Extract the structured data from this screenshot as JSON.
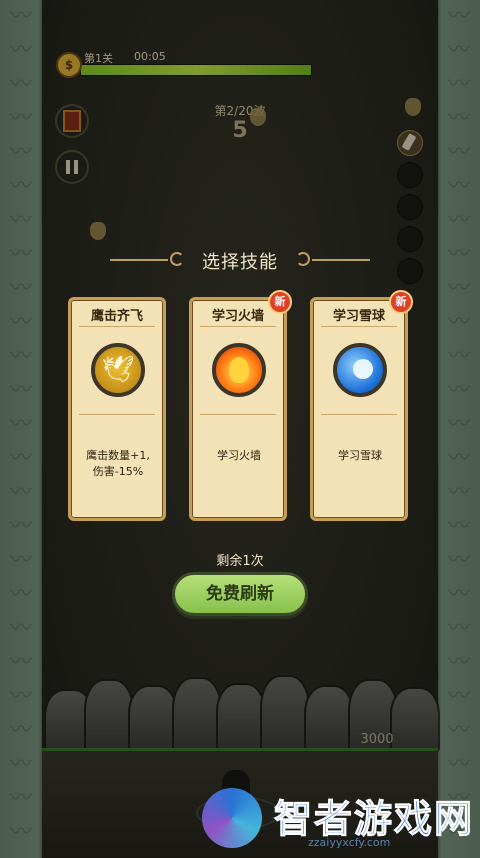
{
  "hud": {
    "level_name": "第1关",
    "timer": "00:05",
    "level_icon_glyph": "$",
    "progress_fraction": 1.0,
    "wave_label": "第2/20波",
    "wave_number": "5"
  },
  "dialog": {
    "title": "选择技能",
    "remaining": "剩余1次",
    "refresh_label": "免费刷新"
  },
  "skills": [
    {
      "name": "鹰击齐飞",
      "description": "鹰击数量+1,\n伤害-15%",
      "icon": "eagle-icon",
      "is_new": false
    },
    {
      "name": "学习火墙",
      "description": "学习火墙",
      "icon": "firewall-icon",
      "is_new": true,
      "badge": "新"
    },
    {
      "name": "学习雪球",
      "description": "学习雪球",
      "icon": "snowball-icon",
      "is_new": true,
      "badge": "新"
    }
  ],
  "ground": {
    "score": "3000"
  },
  "watermark": {
    "text": "智者游戏网",
    "url": "zzaiyyxcfy.com"
  },
  "colors": {
    "card_bg": "#f3e2b5",
    "card_border": "#c89e54",
    "refresh_button": "#9fd05e",
    "new_badge": "#e0402a",
    "progress_fill": "#a6e23a"
  }
}
